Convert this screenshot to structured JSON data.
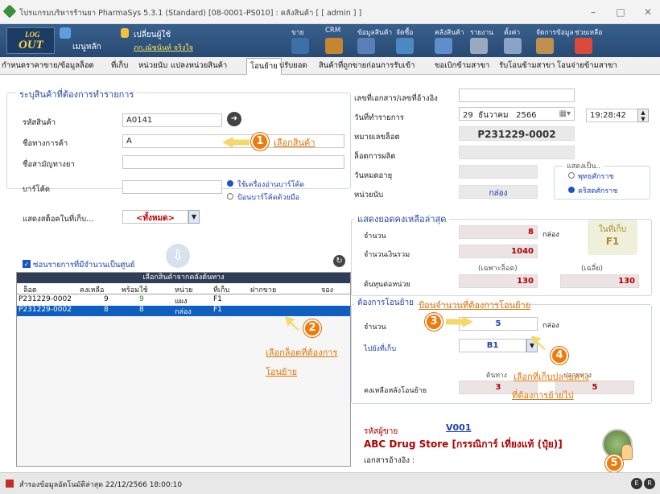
{
  "window": {
    "title": "โปรแกรมบริหารร้านยา PharmaSys 5.3.1 (Standard) [08-0001-PS010] : คลังสินค้า  [ [ admin ] ]"
  },
  "toolbar": {
    "logout_top": "LOG",
    "logout_bottom": "OUT",
    "home": "เมนูหลัก",
    "change_user": "เปลี่ยนผู้ใช้",
    "user_name": "ภก.ณัชนันท์ จริงใจ",
    "items": [
      "ขาย",
      "CRM",
      "ข้อมูลสินค้า",
      "จัดซื้อ",
      "คลังสินค้า",
      "รายงาน",
      "ตั้งค่า",
      "จัดการข้อมูล",
      "ช่วยเหลือ"
    ]
  },
  "tabs": [
    "กำหนดราคาขาย/ข้อมูลล็อต",
    "ที่เก็บ",
    "หน่วยนับ",
    "แปลงหน่วยสินค้า",
    "โอนย้าย",
    "ปรับยอด",
    "สินค้าที่ถูกขายก่อนการรับเข้า",
    "ขอเบิกข้ามสาขา",
    "รับโอนข้ามสาขา",
    "โอนจ่ายข้ามสาขา"
  ],
  "left": {
    "legend": "ระบุสินค้าที่ต้องการทำรายการ",
    "code_label": "รหัสสินค้า",
    "code": "A0141",
    "trade_label": "ชื่อทางการค้า",
    "trade": "A",
    "generic_label": "ชื่อสามัญทางยา",
    "barcode_label": "บาร์โค้ด",
    "radio1": "ใช้เครื่องอ่านบาร์โค้ด",
    "radio2": "ป้อนบาร์โค้ดด้วยมือ",
    "stock_label": "แสดงสต็อคในที่เก็บ...",
    "stock_select": "<ทั้งหมด>",
    "hide_zero": "ซ่อนรายการที่มีจำนวนเป็นศูนย์"
  },
  "grid": {
    "title": "เลือกสินค้าจากคลังต้นทาง",
    "headers": [
      "ล็อต",
      "คงเหลือ",
      "พร้อมใช้",
      "หน่วย",
      "ที่เก็บ",
      "ฝากขาย",
      "จอง"
    ],
    "rows": [
      [
        "P231229-0002",
        "9",
        "9",
        "แผง",
        "F1",
        "",
        ""
      ],
      [
        "P231229-0002",
        "8",
        "8",
        "กล่อง",
        "F1",
        "",
        ""
      ]
    ]
  },
  "right": {
    "doc_label": "เลขที่เอกสาร/เลขที่อ้างอิง",
    "date_label": "วันที่ทำรายการ",
    "date_day": "29",
    "date_month": "ธันวาคม",
    "date_year": "2566",
    "time": "19:28:42",
    "lot_label": "หมายเลขล็อต",
    "lot": "P231229-0002",
    "mfg_label": "ล็อตการผลิต",
    "exp_label": "วันหมดอายุ",
    "unit_label": "หน่วยนับ",
    "unit": "กล่อง",
    "era_legend": "แสดงเป็น..",
    "era1": "พุทธศักราช",
    "era2": "คริสตศักราช"
  },
  "balance": {
    "legend": "แสดงยอดคงเหลือล่าสุด",
    "qty_label": "จำนวน",
    "qty": "8",
    "qty_unit": "กล่อง",
    "amt_label": "จำนวนเงินรวม",
    "amt": "1040",
    "lot_only": "(เฉพาะล็อต)",
    "avg": "(เฉลี่ย)",
    "cost_label": "ต้นทุนต่อหน่วย",
    "cost_lot": "130",
    "cost_avg": "130",
    "store_badge": "ในที่เก็บ",
    "store_code": "F1"
  },
  "transfer": {
    "legend": "ต้องการโอนย้าย",
    "qty_label": "จำนวน",
    "qty": "5",
    "unit": "กล่อง",
    "to_label": "ไปยังที่เก็บ",
    "to": "B1",
    "after_label": "คงเหลือหลังโอนย้าย",
    "src_label": "ต้นทาง",
    "dst_label": "ปลายทาง",
    "src_after": "3",
    "dst_after": "5"
  },
  "vendor": {
    "code_label": "รหัสผู้ขาย",
    "code": "V001",
    "name": "ABC Drug Store [กรรณิการ์ เที่ยงแท้ (ปุ๋ย)]",
    "ref_label": "เอกสารอ้างอิง :"
  },
  "callouts": {
    "c1": "เลือกสินค้า",
    "c2a": "เลือกล็อตที่ต้องการ",
    "c2b": "โอนย้าย",
    "c3": "ป้อนจำนวนที่ต้องการโอนย้าย",
    "c4a": "เลือกที่เก็บปลายทาง",
    "c4b": "ที่ต้องการย้ายไป"
  },
  "status": {
    "text": "สำรองข้อมูลอัตโนมัติล่าสุด  22/12/2566 18:00:10"
  },
  "colors": {
    "toolbar": "#2f5580",
    "accent": "#f07a0a",
    "selected_row": "#0e5fc0"
  }
}
